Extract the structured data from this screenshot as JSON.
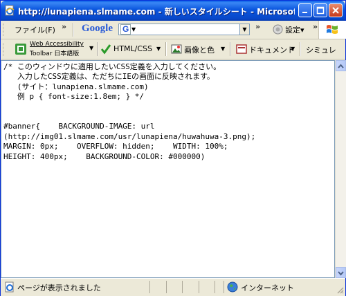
{
  "window": {
    "title": "http://lunapiena.slmame.com - 新しいスタイルシート - Microsof...",
    "title_icon": "ie-page-icon"
  },
  "toolbar1": {
    "file_menu": "ファイル(F)",
    "overflow": "»",
    "google_logo": "Google",
    "g_button": "G",
    "settings_label": "設定▾"
  },
  "toolbar2": {
    "web_accessibility_line1": "Web Accessibility",
    "web_accessibility_line2": "Toolbar 日本語版",
    "html_css": "HTML/CSS",
    "image_color": "画像と色",
    "document": "ドキュメント",
    "simulation": "シミュレ"
  },
  "editor": {
    "text": "/* このウィンドウに適用したいCSS定義を入力してください。\n   入力したCSS定義は、ただちにIEの画面に反映されます。\n   (サイト：lunapiena.slmame.com)\n   例 p { font-size:1.8em; } */\n\n\n#banner{    BACKGROUND-IMAGE: url\n(http://img01.slmame.com/usr/lunapiena/huwahuwa-3.png);\nMARGIN: 0px;    OVERFLOW: hidden;    WIDTH: 100%;\nHEIGHT: 400px;    BACKGROUND-COLOR: #000000)"
  },
  "status": {
    "message": "ページが表示されました",
    "zone": "インターネット"
  },
  "colors": {
    "titlebar": "#0a55dd",
    "chrome": "#ece9d8",
    "close": "#c8391a"
  }
}
